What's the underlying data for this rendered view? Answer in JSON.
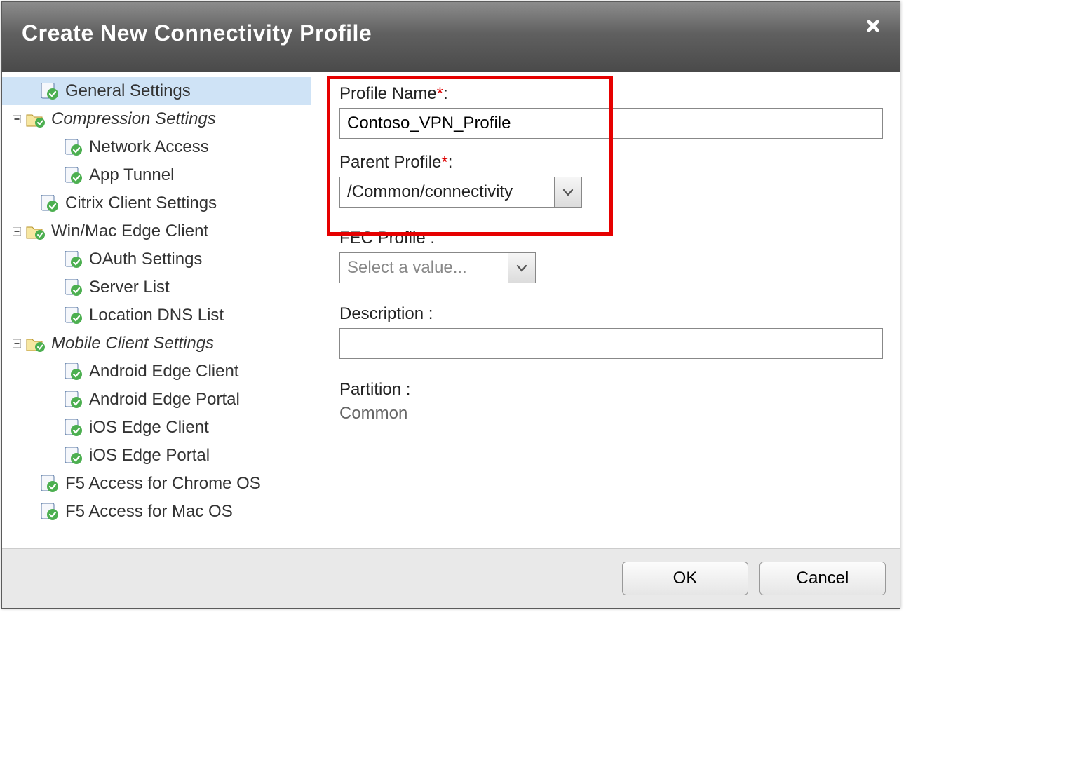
{
  "dialog": {
    "title": "Create New Connectivity Profile"
  },
  "tree": {
    "general": "General Settings",
    "compression": "Compression Settings",
    "network_access": "Network Access",
    "app_tunnel": "App Tunnel",
    "citrix": "Citrix Client Settings",
    "winmac": "Win/Mac Edge Client",
    "oauth": "OAuth Settings",
    "server_list": "Server List",
    "location_dns": "Location DNS List",
    "mobile": "Mobile Client Settings",
    "android_client": "Android Edge Client",
    "android_portal": "Android Edge Portal",
    "ios_client": "iOS Edge Client",
    "ios_portal": "iOS Edge Portal",
    "f5_chrome": "F5 Access for Chrome OS",
    "f5_mac": "F5 Access for Mac OS"
  },
  "form": {
    "profile_name_label": "Profile Name",
    "profile_name_value": "Contoso_VPN_Profile",
    "parent_profile_label": "Parent Profile",
    "parent_profile_value": "/Common/connectivity",
    "fec_label": "FEC Profile :",
    "fec_placeholder": "Select a value...",
    "description_label": "Description :",
    "description_value": "",
    "partition_label": "Partition :",
    "partition_value": "Common"
  },
  "footer": {
    "ok": "OK",
    "cancel": "Cancel"
  }
}
